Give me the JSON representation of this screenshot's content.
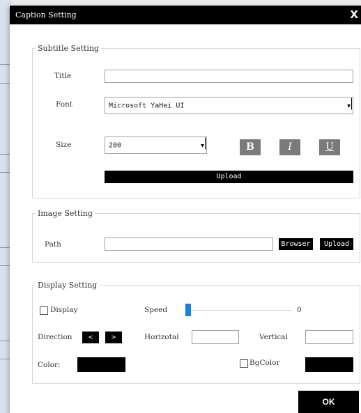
{
  "dialog": {
    "title": "Caption Setting",
    "close_glyph": "X",
    "ok_label": "OK"
  },
  "subtitle": {
    "legend": "Subtitle Setting",
    "title_label": "Title",
    "title_value": "",
    "font_label": "Font",
    "font_value": "Microsoft YaHei UI",
    "size_label": "Size",
    "size_value": "200",
    "bold_label": "B",
    "italic_label": "I",
    "underline_label": "U",
    "upload_label": "Upload"
  },
  "image": {
    "legend": "Image Setting",
    "path_label": "Path",
    "path_value": "",
    "browser_label": "Browser",
    "upload_label": "Upload"
  },
  "display": {
    "legend": "Display Setting",
    "display_label": "Display",
    "display_checked": false,
    "speed_label": "Speed",
    "speed_value": "0",
    "direction_label": "Direction",
    "left_glyph": "<",
    "right_glyph": ">",
    "horizontal_label": "Horizotal",
    "horizontal_value": "",
    "vertical_label": "Vertical",
    "vertical_value": "",
    "color_label": "Color:",
    "color_value": "#000000",
    "bgcolor_label": "BgColor",
    "bgcolor_checked": false,
    "bgcolor_value": "#000000"
  },
  "colors": {
    "titlebar": "#000000",
    "style_button": "#7a7a7a",
    "slider_thumb": "#1a7fe0"
  }
}
